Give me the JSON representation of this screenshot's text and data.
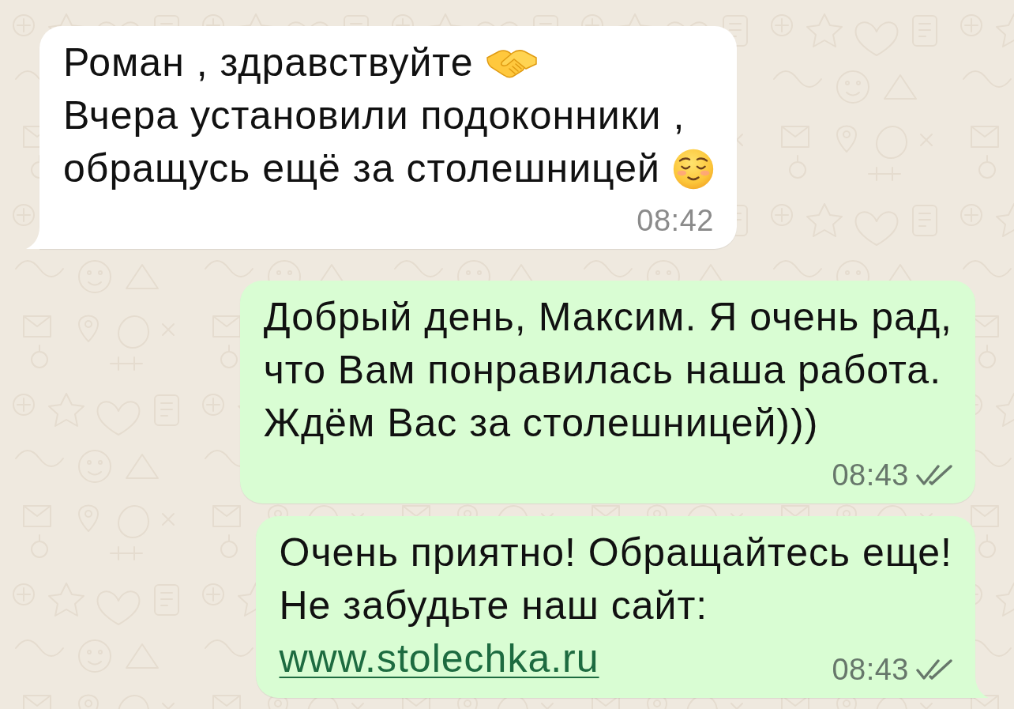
{
  "messages": [
    {
      "outgoing": false,
      "tail": true,
      "lines": [
        [
          {
            "kind": "text",
            "text": "Роман , здравствуйте"
          },
          {
            "kind": "handshake"
          }
        ],
        [
          {
            "kind": "text",
            "text": "Вчера установили подоконники ,"
          }
        ],
        [
          {
            "kind": "text",
            "text": "обращусь ещё за столешницей"
          },
          {
            "kind": "relieved-face"
          }
        ]
      ],
      "time": "08:42"
    },
    {
      "outgoing": true,
      "tail": false,
      "lines": [
        [
          {
            "kind": "text",
            "text": "Добрый день, Максим. Я очень рад,"
          }
        ],
        [
          {
            "kind": "text",
            "text": "что Вам понравилась наша работа."
          }
        ],
        [
          {
            "kind": "text",
            "text": "Ждём Вас за столешницей)))"
          }
        ]
      ],
      "time": "08:43",
      "delivered": true,
      "read": false
    },
    {
      "outgoing": true,
      "tail": true,
      "lines": [
        [
          {
            "kind": "text",
            "text": "Очень приятно! Обращайтесь еще!"
          }
        ],
        [
          {
            "kind": "text",
            "text": "Не забудьте наш сайт:"
          }
        ],
        [
          {
            "kind": "link",
            "text": "www.stolechka.ru"
          }
        ]
      ],
      "time": "08:43",
      "delivered": true,
      "read": false
    }
  ]
}
